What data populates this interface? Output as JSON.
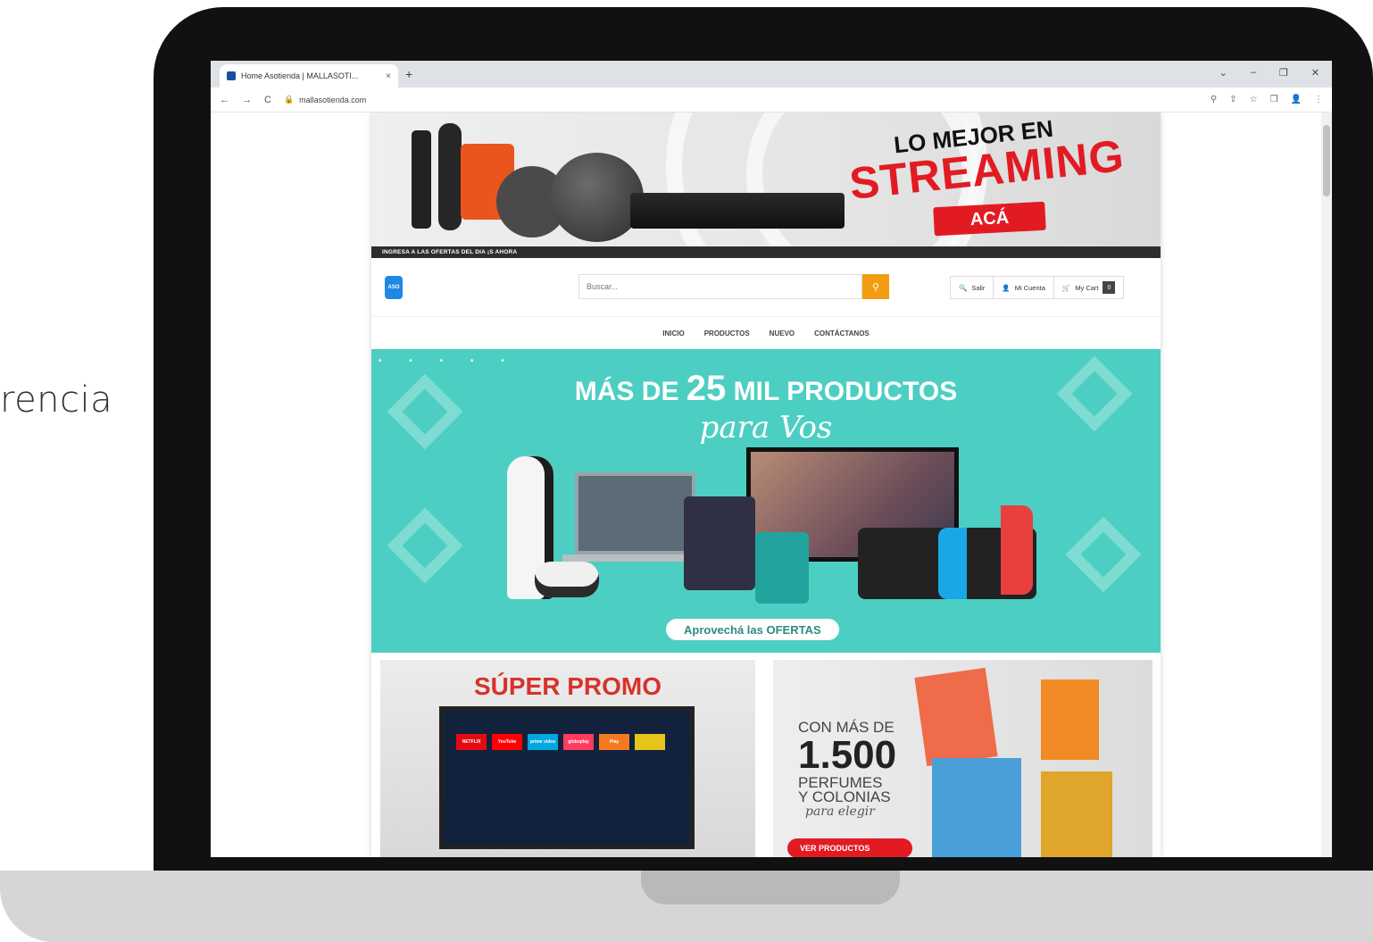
{
  "side_text": "rencia",
  "browser": {
    "tab_title": "Home Asotienda | MALLASOTI...",
    "tab_close": "×",
    "new_tab": "+",
    "url": "mallasotienda.com",
    "nav": [
      "←",
      "→",
      "C"
    ],
    "window_controls": [
      "⌄",
      "–",
      "❐",
      "✕"
    ],
    "toolbar_icons": [
      "⚲",
      "⇪",
      "☆",
      "❒",
      "👤",
      "⋮"
    ]
  },
  "top_banner": {
    "line1": "LO MEJOR EN",
    "line2": "STREAMING",
    "cta": "ACÁ",
    "strip": "INGRESA A LAS OFERTAS DEL DIA ¡S AHORA"
  },
  "header": {
    "logo_text": "ASO",
    "search_placeholder": "Buscar...",
    "search_icon": "⚲",
    "actions": [
      {
        "icon": "🔍",
        "label": "Salir"
      },
      {
        "icon": "👤",
        "label": "Mi Cuenta"
      },
      {
        "icon": "🛒",
        "label": "My Cart",
        "count": "0"
      }
    ]
  },
  "nav": [
    "INICIO",
    "PRODUCTOS",
    "NUEVO",
    "CONTÁCTANOS"
  ],
  "hero": {
    "title_pre": "MÁS DE ",
    "title_num": "25",
    "title_post": "MIL PRODUCTOS",
    "subtitle": "para Vos",
    "cta": "Aprovechá las OFERTAS"
  },
  "promo_tv": {
    "title": "SÚPER PROMO",
    "apps": [
      "NETFLIX",
      "YouTube",
      "prime video",
      "globoplay",
      "Play",
      ""
    ]
  },
  "promo_perfume": {
    "line1": "CON MÁS DE",
    "big": "1.500",
    "line3a": "PERFUMES",
    "line3b": "Y COLONIAS",
    "line4": "para elegir",
    "cta": "VER PRODUCTOS"
  },
  "colors": {
    "teal": "#4ccfc2",
    "red": "#e21b23",
    "orange": "#f39c12"
  }
}
